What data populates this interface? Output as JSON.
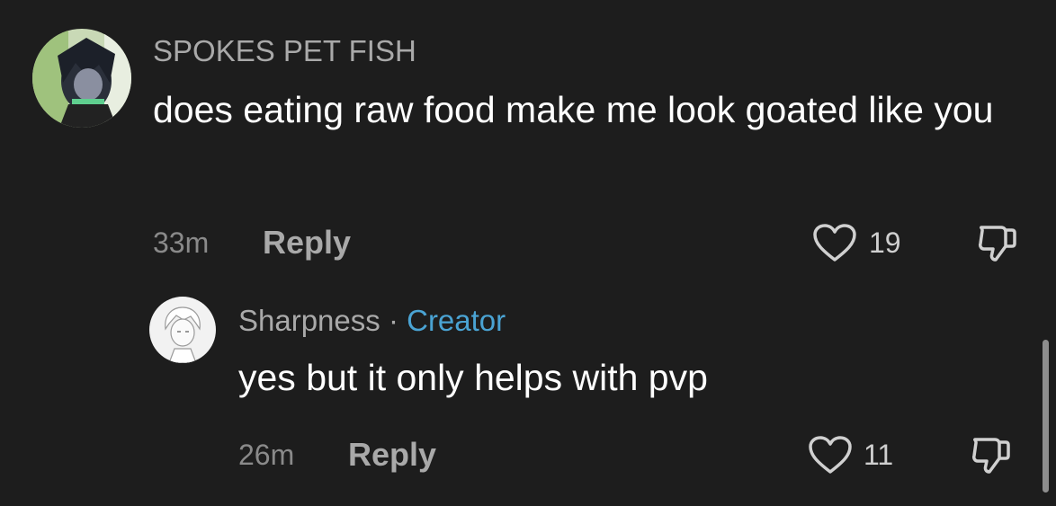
{
  "comment": {
    "author": "SPOKES PET FISH",
    "text": "does eating raw food make me look goated like you",
    "time": "33m",
    "reply_label": "Reply",
    "likes": "19"
  },
  "reply": {
    "author": "Sharpness",
    "separator": "·",
    "badge": "Creator",
    "text": "yes but it only helps with pvp",
    "time": "26m",
    "reply_label": "Reply",
    "likes": "11"
  },
  "icons": {
    "like": "heart-outline-icon",
    "dislike": "thumbs-down-icon"
  },
  "colors": {
    "background": "#1d1d1d",
    "creator_badge": "#4aa3d3",
    "username": "#a9a9a9"
  }
}
